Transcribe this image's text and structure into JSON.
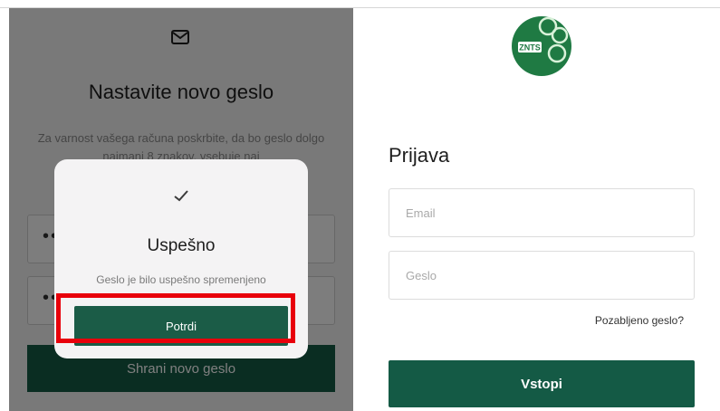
{
  "reset_screen": {
    "title": "Nastavite novo geslo",
    "description": "Za varnost vašega računa poskrbite, da bo geslo dolgo najmanj 8 znakov, vsebuje naj",
    "password_mask": "••••••••",
    "confirm_mask": "••••••••",
    "save_button": "Shrani novo geslo",
    "icon": "mail-icon"
  },
  "success_dialog": {
    "icon": "check-icon",
    "title": "Uspešno",
    "message": "Geslo je bilo uspešno spremenjeno",
    "confirm_button": "Potrdi",
    "highlight_color": "#e8000b"
  },
  "login_screen": {
    "logo_text": "ZNTS",
    "title": "Prijava",
    "email_placeholder": "Email",
    "password_placeholder": "Geslo",
    "forgot_password": "Pozabljeno geslo?",
    "login_button": "Vstopi"
  },
  "colors": {
    "accent": "#145a45",
    "logo_green": "#1f7a43"
  }
}
